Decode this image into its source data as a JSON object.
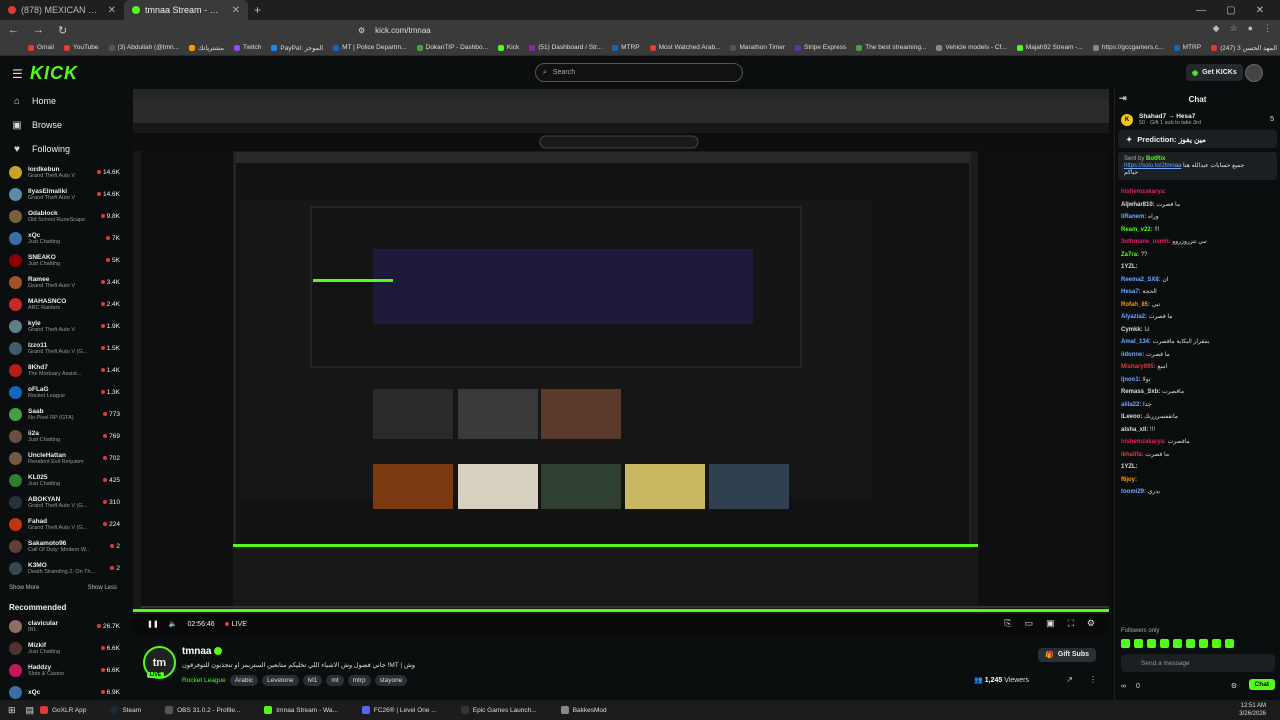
{
  "tabs": [
    {
      "label": "(878) MEXICAN OLDSCHOOL RAP! 1",
      "color": "#e53935",
      "active": false
    },
    {
      "label": "tmnaa Stream - Watch Live on K",
      "color": "#53fc18",
      "active": true
    }
  ],
  "address": {
    "url": "kick.com/tmnaa"
  },
  "bookmarks": [
    {
      "label": "Gmail",
      "color": "#e53935"
    },
    {
      "label": "YouTube",
      "color": "#e53935"
    },
    {
      "label": "(3) Abdullah (@tmn...",
      "color": "#555"
    },
    {
      "label": "مشترياتك",
      "color": "#ff9800"
    },
    {
      "label": "Twitch",
      "color": "#9146ff"
    },
    {
      "label": "PayPal: الموجز",
      "color": "#1e88e5"
    },
    {
      "label": "MT | Police Departm...",
      "color": "#1565c0"
    },
    {
      "label": "DokanTIP - Dashbo...",
      "color": "#43a047"
    },
    {
      "label": "Kick",
      "color": "#53fc18"
    },
    {
      "label": "(51) Dashboard / Str...",
      "color": "#8e24aa"
    },
    {
      "label": "MTRP",
      "color": "#1565c0"
    },
    {
      "label": "Most Watched Arab...",
      "color": "#e53935"
    },
    {
      "label": "Marathon Timer",
      "color": "#555"
    },
    {
      "label": "Stripe Express",
      "color": "#5e35b1"
    },
    {
      "label": "The best streaming...",
      "color": "#43a047"
    },
    {
      "label": "Vehicle models - Cf...",
      "color": "#888"
    },
    {
      "label": "Majah92 Stream -...",
      "color": "#53fc18"
    },
    {
      "label": "https://gccgamers.c...",
      "color": "#888"
    },
    {
      "label": "MTRP",
      "color": "#1565c0"
    },
    {
      "label": "المهد الحسن 3 (247)",
      "color": "#e53935"
    }
  ],
  "kick": {
    "logo": "KICK",
    "search_placeholder": "Search",
    "get_kicks": "Get KICKs"
  },
  "sidebar": {
    "nav": [
      {
        "label": "Home",
        "icon": "⌂"
      },
      {
        "label": "Browse",
        "icon": "▣"
      },
      {
        "label": "Following",
        "icon": "♥"
      }
    ],
    "following": [
      {
        "name": "lordkebun",
        "cat": "Grand Theft Auto V",
        "views": "14.6K",
        "color": "#c9a227"
      },
      {
        "name": "IlyasElmaliki",
        "cat": "Grand Theft Auto V",
        "views": "14.6K",
        "color": "#5d8aa8"
      },
      {
        "name": "Odablock",
        "cat": "Old School RuneScape",
        "views": "9.8K",
        "color": "#7b5e3b"
      },
      {
        "name": "xQc",
        "cat": "Just Chatting",
        "views": "7K",
        "color": "#3a6ea5"
      },
      {
        "name": "SNEAKO",
        "cat": "Just Chatting",
        "views": "5K",
        "color": "#8b0000"
      },
      {
        "name": "Ramee",
        "cat": "Grand Theft Auto V",
        "views": "3.4K",
        "color": "#a0522d"
      },
      {
        "name": "MAHASNCO",
        "cat": "ARC Raiders",
        "views": "2.4K",
        "color": "#c62828"
      },
      {
        "name": "kyle",
        "cat": "Grand Theft Auto V",
        "views": "1.9K",
        "color": "#607d8b"
      },
      {
        "name": "lzzo11",
        "cat": "Grand Theft Auto V (G...",
        "views": "1.5K",
        "color": "#455a64"
      },
      {
        "name": "8Khd7",
        "cat": "The Mortuary Assist...",
        "views": "1.4K",
        "color": "#b71c1c"
      },
      {
        "name": "oFLaG",
        "cat": "Rocket League",
        "views": "1.3K",
        "color": "#1565c0"
      },
      {
        "name": "Saab",
        "cat": "No Pixel RP (GTA)",
        "views": "773",
        "color": "#43a047"
      },
      {
        "name": "ii2a",
        "cat": "Just Chatting",
        "views": "769",
        "color": "#6d4c41"
      },
      {
        "name": "UncleHattan",
        "cat": "Resident Evil Requiem",
        "views": "702",
        "color": "#795548"
      },
      {
        "name": "KL025",
        "cat": "Just Chatting",
        "views": "425",
        "color": "#2e7d32"
      },
      {
        "name": "ABOKYAN",
        "cat": "Grand Theft Auto V (G...",
        "views": "310",
        "color": "#263238"
      },
      {
        "name": "Fahad",
        "cat": "Grand Theft Auto V (G...",
        "views": "224",
        "color": "#bf360c"
      },
      {
        "name": "Sakamoto96",
        "cat": "Call Of Duty: Modern W...",
        "views": "2",
        "color": "#5d4037"
      },
      {
        "name": "K3MO",
        "cat": "Death Stranding 2: On Th...",
        "views": "2",
        "color": "#37474f"
      }
    ],
    "show_more": "Show More",
    "show_less": "Show Less",
    "recommended_title": "Recommended",
    "recommended": [
      {
        "name": "clavicular",
        "cat": "IRL",
        "views": "26.7K",
        "color": "#8d6e63"
      },
      {
        "name": "Mizkif",
        "cat": "Just Chatting",
        "views": "6.6K",
        "color": "#4e342e"
      },
      {
        "name": "Haddzy",
        "cat": "Slots & Casino",
        "views": "6.6K",
        "color": "#c2185b"
      },
      {
        "name": "xQc",
        "cat": "",
        "views": "6.9K",
        "color": "#3a6ea5"
      }
    ]
  },
  "player": {
    "time": "02:56:46",
    "live": "LIVE"
  },
  "stream": {
    "avatar_text": "tm",
    "live_badge": "LIVE",
    "name": "tmnaa",
    "title": "جاني فضول وش الاشياء اللي تخليكم متابعين الستريمر او تنجذبون للتوفرقون !MT | وش",
    "category": "Rocket League",
    "tags": [
      "Arabic",
      "Levelone",
      "lvl1",
      "mt",
      "mtrp",
      "stayone"
    ],
    "gift_subs": "Gift Subs",
    "viewers": "1,245",
    "viewers_label": "Viewers"
  },
  "chat": {
    "title": "Chat",
    "pinned_user": "Shahad7",
    "pinned_target": "Hesa7",
    "pinned_count": "50",
    "pinned_sub": "Gift 1 sub to take 3rd",
    "pinned_num": "5",
    "prediction": "Prediction: مين يفوز",
    "bot_name": "BotRix",
    "bot_label": "Sent by",
    "bot_link": "https://solo.to/2tmnaa",
    "bot_text": "جميع حسابات عبدالله هنا",
    "bot_text2": "حياكم",
    "messages": [
      {
        "u": "hishemzakarya:",
        "t": "",
        "c": "#e91e63"
      },
      {
        "u": "Aljwhar810:",
        "t": "ما قصرت",
        "c": "#ddd"
      },
      {
        "u": "IiRanem:",
        "t": "وراه",
        "c": "#6fa8ff"
      },
      {
        "u": "Ream_v22:",
        "t": "!!!",
        "c": "#53fc18"
      },
      {
        "u": "3othmane_usmh:",
        "t": "تبي تتزروزروو",
        "c": "#e91e63"
      },
      {
        "u": "Za7ra:",
        "t": "??",
        "c": "#53fc18"
      },
      {
        "u": "1YZL:",
        "t": "",
        "c": "#ddd"
      },
      {
        "u": "Reema2_SX8:",
        "t": "ان",
        "c": "#6fa8ff"
      },
      {
        "u": "Hesa7:",
        "t": "الحجة",
        "c": "#6fa8ff"
      },
      {
        "u": "Rofah_85:",
        "t": "تبي",
        "c": "#ff9800"
      },
      {
        "u": "Alyazia2:",
        "t": "ما قصرت",
        "c": "#6fa8ff"
      },
      {
        "u": "Cymkk:",
        "t": "انا",
        "c": "#ddd"
      },
      {
        "u": "Amal_134:",
        "t": "بمقرار البكاية ماقصرت",
        "c": "#6fa8ff"
      },
      {
        "u": "iidonne:",
        "t": "ما قصرت",
        "c": "#6fa8ff"
      },
      {
        "u": "Mishary995:",
        "t": "اسع",
        "c": "#e53935"
      },
      {
        "u": "ljnoo1:",
        "t": "تولا",
        "c": "#6fa8ff"
      },
      {
        "u": "Remass_Sxb:",
        "t": "ماقصرت",
        "c": "#ddd"
      },
      {
        "u": "alila22:",
        "t": "جدا",
        "c": "#6fa8ff"
      },
      {
        "u": "lLeeoo:",
        "t": "ماتقفسرررنك",
        "c": "#ddd"
      },
      {
        "u": "alsha_xll:",
        "t": "!!!",
        "c": "#ddd"
      },
      {
        "u": "hishemzakarya:",
        "t": "ماقصرت",
        "c": "#e91e63"
      },
      {
        "u": "ikhalifa:",
        "t": "ما قصرت",
        "c": "#e53935"
      },
      {
        "u": "1YZL:",
        "t": "",
        "c": "#ddd"
      },
      {
        "u": "f6joy:",
        "t": "",
        "c": "#ff9800"
      },
      {
        "u": "toomi29:",
        "t": "بدري",
        "c": "#6fa8ff"
      }
    ],
    "followers_only": "Followers only",
    "input_placeholder": "Send a message",
    "coin_count": "0",
    "chat_button": "Chat"
  },
  "taskbar": [
    {
      "label": "GoXLR App",
      "color": "#e53935"
    },
    {
      "label": "Steam",
      "color": "#1b2838"
    },
    {
      "label": "OBS 31.0.2 - Profile...",
      "color": "#555"
    },
    {
      "label": "tmnaa Stream - Wa...",
      "color": "#53fc18"
    },
    {
      "label": "FC26® | Level One ...",
      "color": "#5865f2"
    },
    {
      "label": "Epic Games Launch...",
      "color": "#333"
    },
    {
      "label": "BakkesMod",
      "color": "#888"
    }
  ],
  "clock": {
    "time": "12:51 AM",
    "date": "3/26/2026"
  }
}
